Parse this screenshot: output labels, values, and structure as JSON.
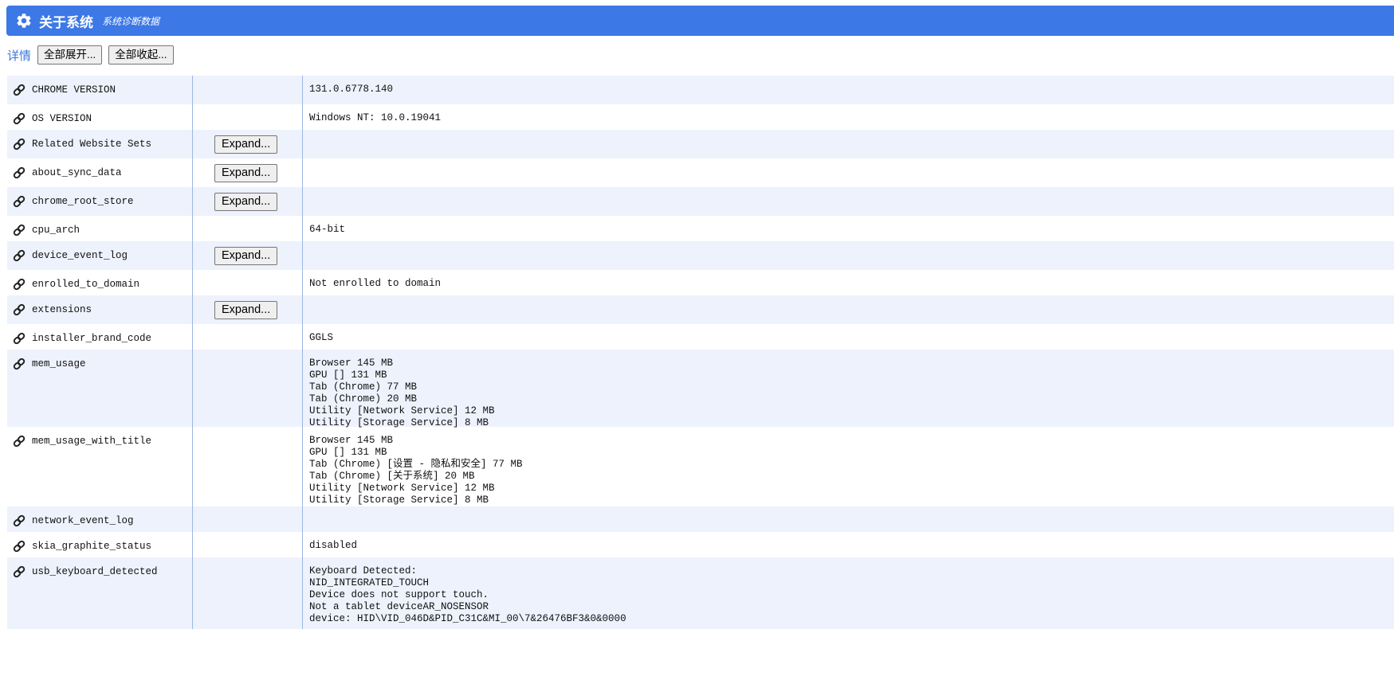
{
  "header": {
    "title": "关于系统",
    "subtitle": "系统诊断数据",
    "icon": "gear-icon"
  },
  "toolbar": {
    "detail_link": "详情",
    "expand_all": "全部展开...",
    "collapse_all": "全部收起..."
  },
  "colors": {
    "header_bg": "#3c78e6",
    "row_shade": "#edf2fc",
    "link": "#3a77d8"
  },
  "rows": [
    {
      "name": "CHROME VERSION",
      "has_button": false,
      "button": "",
      "value": "131.0.6778.140"
    },
    {
      "name": "OS VERSION",
      "has_button": false,
      "button": "",
      "value": "Windows NT: 10.0.19041"
    },
    {
      "name": "Related Website Sets",
      "has_button": true,
      "button": "Expand...",
      "value": ""
    },
    {
      "name": "about_sync_data",
      "has_button": true,
      "button": "Expand...",
      "value": ""
    },
    {
      "name": "chrome_root_store",
      "has_button": true,
      "button": "Expand...",
      "value": ""
    },
    {
      "name": "cpu_arch",
      "has_button": false,
      "button": "",
      "value": "64-bit"
    },
    {
      "name": "device_event_log",
      "has_button": true,
      "button": "Expand...",
      "value": ""
    },
    {
      "name": "enrolled_to_domain",
      "has_button": false,
      "button": "",
      "value": "Not enrolled to domain"
    },
    {
      "name": "extensions",
      "has_button": true,
      "button": "Expand...",
      "value": ""
    },
    {
      "name": "installer_brand_code",
      "has_button": false,
      "button": "",
      "value": "GGLS"
    },
    {
      "name": "mem_usage",
      "has_button": false,
      "button": "",
      "value": "Browser 145 MB\nGPU [] 131 MB\nTab (Chrome) 77 MB\nTab (Chrome) 20 MB\nUtility [Network Service] 12 MB\nUtility [Storage Service] 8 MB"
    },
    {
      "name": "mem_usage_with_title",
      "has_button": false,
      "button": "",
      "value": "Browser 145 MB\nGPU [] 131 MB\nTab (Chrome) [设置 - 隐私和安全] 77 MB\nTab (Chrome) [关于系统] 20 MB\nUtility [Network Service] 12 MB\nUtility [Storage Service] 8 MB"
    },
    {
      "name": "network_event_log",
      "has_button": false,
      "button": "",
      "value": ""
    },
    {
      "name": "skia_graphite_status",
      "has_button": false,
      "button": "",
      "value": "disabled"
    },
    {
      "name": "usb_keyboard_detected",
      "has_button": false,
      "button": "",
      "value": "Keyboard Detected:\nNID_INTEGRATED_TOUCH\nDevice does not support touch.\nNot a tablet deviceAR_NOSENSOR\ndevice: HID\\VID_046D&PID_C31C&MI_00\\7&26476BF3&0&0000"
    }
  ]
}
